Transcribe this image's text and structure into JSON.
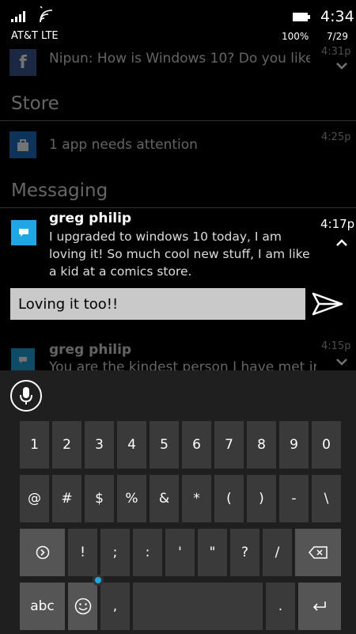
{
  "status_bar": {
    "carrier": "AT&T LTE",
    "time": "4:34",
    "battery_percent": "100%",
    "date": "7/29"
  },
  "notifications": {
    "facebook": {
      "text": "Nipun: How is Windows 10? Do you like",
      "time": "4:31p"
    },
    "store_header": "Store",
    "store": {
      "text": "1 app needs attention",
      "time": "4:25p"
    },
    "messaging_header": "Messaging",
    "active_message": {
      "sender": "greg philip",
      "body": "I upgraded to windows 10 today, I am loving it! So much cool new stuff, I am like a kid at a comics store.",
      "time": "4:17p",
      "reply_value": "Loving it too!!"
    },
    "older_message": {
      "sender": "greg philip",
      "preview": "You are the kindest person I have met ir",
      "time": "4:15p"
    }
  },
  "keyboard": {
    "row1": [
      "1",
      "2",
      "3",
      "4",
      "5",
      "6",
      "7",
      "8",
      "9",
      "0"
    ],
    "row2": [
      "@",
      "#",
      "$",
      "%",
      "&",
      "*",
      "(",
      ")",
      "-",
      "\\"
    ],
    "row3": [
      "!",
      ";",
      ":",
      "'",
      "\"",
      "?",
      "/"
    ],
    "abc_label": "abc",
    "comma": ",",
    "period": "."
  },
  "colors": {
    "accent": "#1fa6e4",
    "facebook": "#3b5998",
    "store": "#1e72c8",
    "reply_box": "#c9c9c9"
  }
}
